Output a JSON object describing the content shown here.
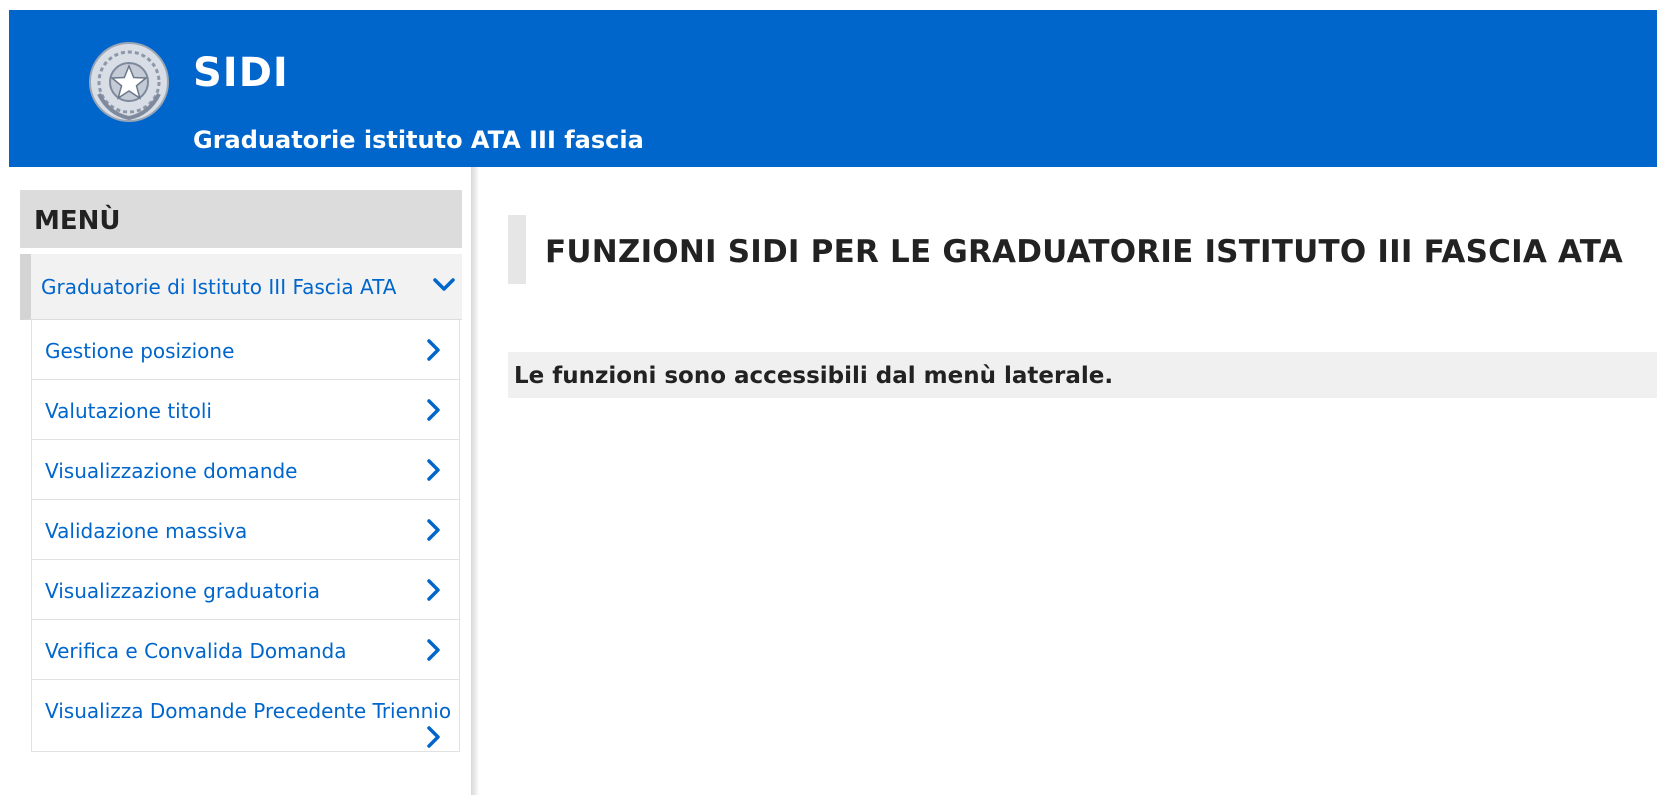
{
  "header": {
    "app_title": "SIDI",
    "app_subtitle": "Graduatorie istituto ATA III fascia",
    "brand_color": "#0066cc",
    "logo_icon": "republic-emblem-icon"
  },
  "sidebar": {
    "title": "MENÙ",
    "section": {
      "label": "Graduatorie di Istituto III Fascia ATA",
      "icon": "chevron-down-icon",
      "expanded": true
    },
    "items": [
      {
        "label": "Gestione posizione",
        "icon": "chevron-right-icon"
      },
      {
        "label": "Valutazione titoli",
        "icon": "chevron-right-icon"
      },
      {
        "label": "Visualizzazione domande",
        "icon": "chevron-right-icon"
      },
      {
        "label": "Validazione massiva",
        "icon": "chevron-right-icon"
      },
      {
        "label": "Visualizzazione graduatoria",
        "icon": "chevron-right-icon"
      },
      {
        "label": "Verifica e Convalida Domanda",
        "icon": "chevron-right-icon"
      },
      {
        "label": "Visualizza Domande Precedente Triennio",
        "icon": "chevron-right-icon"
      }
    ]
  },
  "main": {
    "heading": "FUNZIONI SIDI PER LE GRADUATORIE ISTITUTO III FASCIA ATA",
    "info": "Le funzioni sono accessibili dal menù laterale."
  }
}
